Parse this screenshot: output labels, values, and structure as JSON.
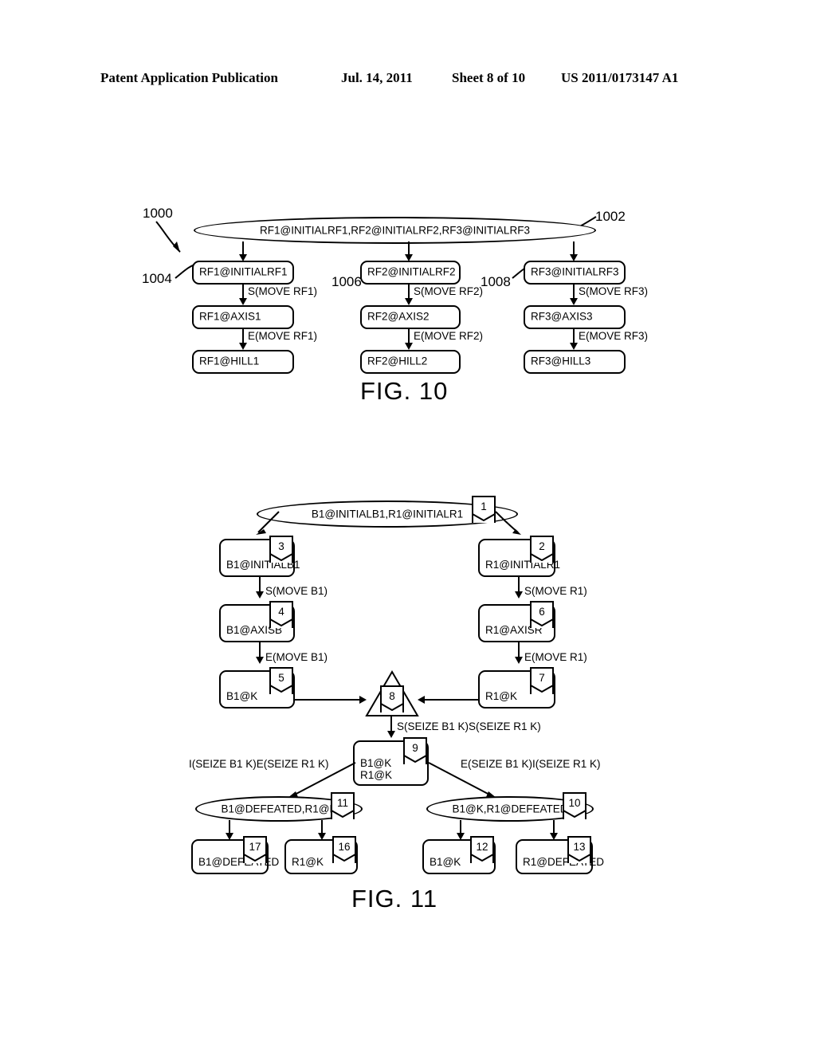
{
  "header": {
    "publication": "Patent Application Publication",
    "date": "Jul. 14, 2011",
    "sheet": "Sheet 8 of 10",
    "number": "US 2011/0173147 A1"
  },
  "figures": [
    {
      "caption": "FIG. 10",
      "refs": [
        {
          "id": "1000",
          "text": "1000"
        },
        {
          "id": "1002",
          "text": "1002"
        },
        {
          "id": "1004",
          "text": "1004"
        },
        {
          "id": "1006",
          "text": "1006"
        },
        {
          "id": "1008",
          "text": "1008"
        }
      ],
      "root_ellipse": "RF1@INITIALRF1,RF2@INITIALRF2,RF3@INITIALRF3",
      "columns": [
        {
          "nodes": [
            "RF1@INITIALRF1",
            "RF1@AXIS1",
            "RF1@HILL1"
          ],
          "edges": [
            "S(MOVE RF1)",
            "E(MOVE RF1)"
          ]
        },
        {
          "nodes": [
            "RF2@INITIALRF2",
            "RF2@AXIS2",
            "RF2@HILL2"
          ],
          "edges": [
            "S(MOVE RF2)",
            "E(MOVE RF2)"
          ]
        },
        {
          "nodes": [
            "RF3@INITIALRF3",
            "RF3@AXIS3",
            "RF3@HILL3"
          ],
          "edges": [
            "S(MOVE RF3)",
            "E(MOVE RF3)"
          ]
        }
      ]
    },
    {
      "caption": "FIG. 11",
      "root_ellipse": {
        "label": "B1@INITIALB1,R1@INITIALR1",
        "badge": "1"
      },
      "left_column": {
        "nodes": [
          {
            "label": "B1@INITIALB1",
            "badge": "3"
          },
          {
            "label": "B1@AXISB",
            "badge": "4"
          },
          {
            "label": "B1@K",
            "badge": "5"
          }
        ],
        "edges": [
          "S(MOVE B1)",
          "E(MOVE B1)"
        ]
      },
      "right_column": {
        "nodes": [
          {
            "label": "R1@INITIALR1",
            "badge": "2"
          },
          {
            "label": "R1@AXISR",
            "badge": "6"
          },
          {
            "label": "R1@K",
            "badge": "7"
          }
        ],
        "edges": [
          "S(MOVE R1)",
          "E(MOVE R1)"
        ]
      },
      "junction": {
        "badge": "8"
      },
      "junction_edge": "S(SEIZE B1 K)S(SEIZE R1 K)",
      "merge_node": {
        "line1": "B1@K",
        "line2": "R1@K",
        "badge": "9"
      },
      "fork_left_edge": "I(SEIZE B1 K)E(SEIZE R1 K)",
      "fork_right_edge": "E(SEIZE B1 K)I(SEIZE R1 K)",
      "left_ellipse": {
        "label": "B1@DEFEATED,R1@K",
        "badge": "11"
      },
      "right_ellipse": {
        "label": "B1@K,R1@DEFEATED",
        "badge": "10"
      },
      "leaf_nodes": [
        {
          "label": "B1@DEFEATED",
          "badge": "17"
        },
        {
          "label": "R1@K",
          "badge": "16"
        },
        {
          "label": "B1@K",
          "badge": "12"
        },
        {
          "label": "R1@DEFEATED",
          "badge": "13"
        }
      ]
    }
  ]
}
